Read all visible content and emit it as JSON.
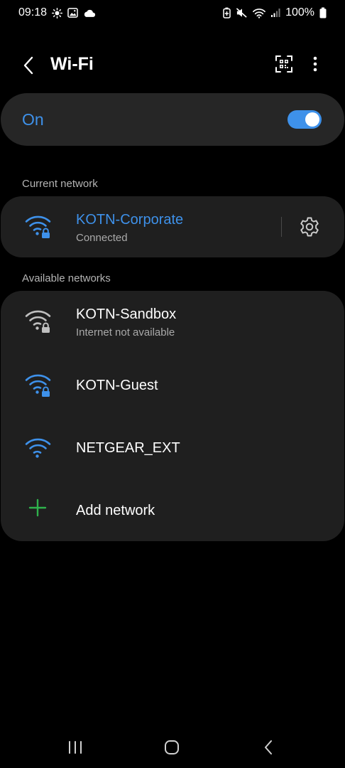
{
  "status_bar": {
    "time": "09:18",
    "battery": "100%",
    "left_icons": [
      "brightness-icon",
      "gallery-icon",
      "cloud-icon"
    ],
    "right_icons": [
      "battery-saver-icon",
      "mute-icon",
      "wifi-status-icon",
      "signal-icon",
      "battery-icon"
    ]
  },
  "header": {
    "title": "Wi-Fi"
  },
  "wifi_toggle": {
    "label": "On",
    "state": "on",
    "accent": "#3e91ea"
  },
  "current_network": {
    "section_title": "Current network",
    "name": "KOTN-Corporate",
    "status": "Connected",
    "secured": true,
    "signal_color": "#3e91ea"
  },
  "available_networks": {
    "section_title": "Available networks",
    "items": [
      {
        "name": "KOTN-Sandbox",
        "status": "Internet not available",
        "secured": true,
        "signal_color": "#bfbfbf"
      },
      {
        "name": "KOTN-Guest",
        "status": "",
        "secured": true,
        "signal_color": "#3e91ea"
      },
      {
        "name": "NETGEAR_EXT",
        "status": "",
        "secured": false,
        "signal_color": "#3e91ea"
      }
    ],
    "add_label": "Add network",
    "add_color": "#2fb24c"
  },
  "nav": {
    "icons": [
      "recent-apps-icon",
      "home-icon",
      "back-nav-icon"
    ]
  }
}
